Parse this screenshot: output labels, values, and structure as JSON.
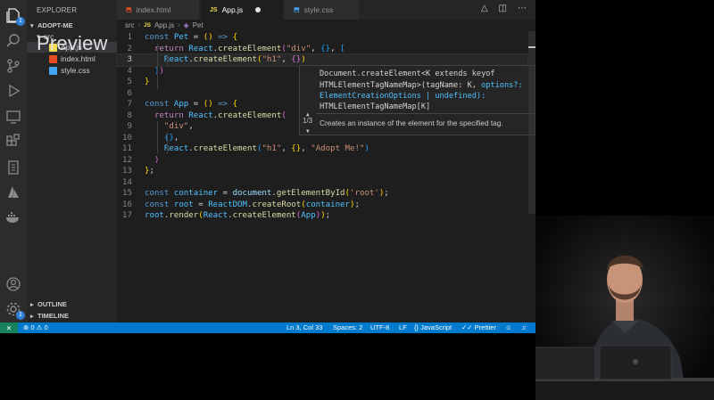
{
  "sidebar": {
    "title": "EXPLORER",
    "root": "ADOPT-ME",
    "items": [
      {
        "label": "src",
        "type": "folder"
      },
      {
        "label": "App.js",
        "type": "js"
      },
      {
        "label": "index.html",
        "type": "html"
      },
      {
        "label": "style.css",
        "type": "css"
      }
    ],
    "outline": "OUTLINE",
    "timeline": "TIMELINE",
    "overlay_text": "Preview"
  },
  "activity": {
    "explorer_badge": "1",
    "settings_badge": "1"
  },
  "tabs": [
    {
      "label": "index.html",
      "icon": "html"
    },
    {
      "label": "App.js",
      "icon": "js",
      "modified": true
    },
    {
      "label": "style.css",
      "icon": "css"
    }
  ],
  "breadcrumb": [
    "src",
    "App.js",
    "Pet"
  ],
  "code_lines": [
    "const Pet = () => {",
    "  return React.createElement(\"div\", {}, [",
    "    React.createElement(\"h1\", {})",
    "  ])",
    "}",
    "",
    "const App = () => {",
    "  return React.createElement(",
    "    \"div\",",
    "    {},",
    "    React.createElement(\"h1\", {}, \"Adopt Me!\")",
    "  )",
    "};",
    "",
    "const container = document.getElementById('root');",
    "const root = ReactDOM.createRoot(container);",
    "root.render(React.createElement(App));"
  ],
  "hover": {
    "signature": [
      "Document.createElement<K extends keyof",
      "HTMLElementTagNameMap>(tagName: K, options?:",
      "ElementCreationOptions | undefined):",
      "HTMLElementTagNameMap[K]"
    ],
    "counter": "1/3",
    "description": "Creates an instance of the element for the specified tag."
  },
  "status": {
    "errors": "0",
    "warnings": "0",
    "position": "Ln 3, Col 33",
    "spaces": "Spaces: 2",
    "encoding": "UTF-8",
    "eol": "LF",
    "language": "JavaScript",
    "formatter": "Prettier"
  },
  "colors": {
    "statusbar": "#007acc",
    "remote": "#16825d",
    "editor_bg": "#1e1e1e",
    "sidebar_bg": "#252526"
  }
}
